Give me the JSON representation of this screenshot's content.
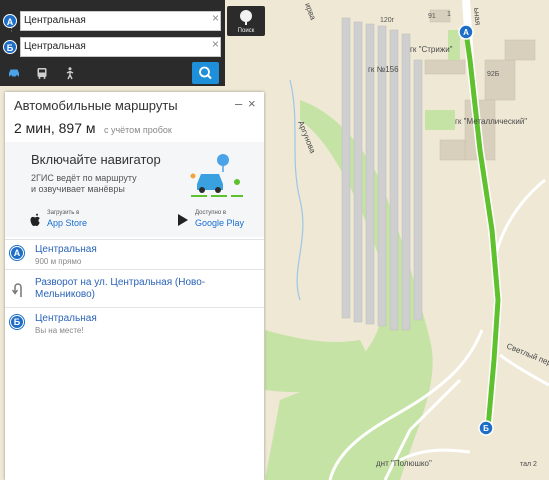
{
  "map": {
    "labels": {
      "gk156": "гк №156",
      "gk_strizhi": "гк \"Стрижи\"",
      "gk_metal": "гк \"Металлический\"",
      "argunova": "Аргунова",
      "svetly": "Светлый пер.",
      "dnt_poloshko": "днт \"Полюшко\"",
      "street_top": "ьная",
      "street_top2": "ирва",
      "house_120": "120г",
      "house_91": "91",
      "house_92b": "92Б",
      "house_1": "1",
      "house_tal2": "тал 2"
    },
    "markers": {
      "a": "А",
      "b": "Б"
    },
    "route_color": "#5fc12d"
  },
  "search": {
    "from_value": "Центральная",
    "to_value": "Центральная",
    "from_marker": "А",
    "to_marker": "Б",
    "clear_glyph": "×",
    "search_button_label": "Поиск",
    "modes": [
      "car-icon",
      "bus-icon",
      "walk-icon"
    ],
    "accent_color": "#1e8fd9"
  },
  "route_card": {
    "title": "Автомобильные маршруты",
    "minimize": "–",
    "close": "×",
    "time_distance": "2 мин, 897 м",
    "note": "с учётом пробок",
    "promo": {
      "title": "Включайте навигатор",
      "line1": "2ГИС ведёт по маршруту",
      "line2": "и озвучивает манёвры",
      "appstore_small": "Загрузить в",
      "appstore_big": "App Store",
      "googleplay_small": "Доступно в",
      "googleplay_big": "Google Play"
    },
    "steps": [
      {
        "marker": "А",
        "title": "Центральная",
        "subtitle": "900 м прямо"
      },
      {
        "title_line1": "Разворот на ул. Центральная (Ново-",
        "title_line2": "Мельниково)"
      },
      {
        "marker": "Б",
        "title": "Центральная",
        "subtitle": "Вы на месте!"
      }
    ]
  }
}
